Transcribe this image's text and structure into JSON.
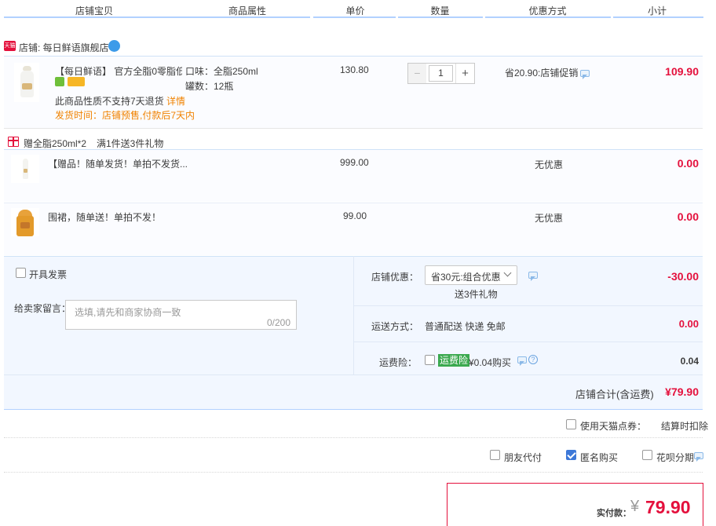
{
  "columns": {
    "shop_item": "店铺宝贝",
    "attributes": "商品属性",
    "unit_price": "单价",
    "quantity": "数量",
    "discount": "优惠方式",
    "subtotal": "小计"
  },
  "shop": {
    "badge": "天猫",
    "name": "店铺: 每日鲜语旗舰店"
  },
  "main_item": {
    "title": "【每日鲜语】 官方全脂0零脂低...",
    "attr_flavor": "口味：全脂250ml",
    "attr_count": "罐数：12瓶",
    "price": "130.80",
    "quantity": "1",
    "qty_minus": "−",
    "qty_plus": "+",
    "discount": "省20.90:店铺促销",
    "subtotal": "109.90",
    "notice": "此商品性质不支持7天退货",
    "notice_link": "详情",
    "ship_time": "发货时间：店铺预售,付款后7天内"
  },
  "gift": {
    "label": "赠全脂250ml*2",
    "rule": "满1件送3件礼物",
    "items": [
      {
        "title": "【赠品！随单发货！单拍不发货...",
        "price": "999.00",
        "discount": "无优惠",
        "subtotal": "0.00"
      },
      {
        "title": "围裙，随单送！单拍不发！",
        "price": "99.00",
        "discount": "无优惠",
        "subtotal": "0.00"
      }
    ]
  },
  "invoice": {
    "label": "开具发票"
  },
  "message": {
    "label": "给卖家留言：",
    "placeholder": "选填,请先和商家协商一致",
    "counter": "0/200"
  },
  "shop_discount": {
    "label": "店铺优惠：",
    "selected": "省30元:组合优惠",
    "sub": "送3件礼物",
    "amount": "-30.00"
  },
  "delivery": {
    "label": "运送方式：",
    "value": "普通配送 快递 免邮",
    "amount": "0.00"
  },
  "insurance": {
    "label": "运费险：",
    "badge": "运费险",
    "value": "¥0.04购买",
    "amount": "0.04"
  },
  "shop_total": {
    "label": "店铺合计(含运费)",
    "amount": "¥79.90"
  },
  "tmall_points": {
    "label": "使用天猫点券：",
    "note": "结算时扣除"
  },
  "options": {
    "friend_pay": "朋友代付",
    "anonymous": "匿名购买",
    "huabei": "花呗分期"
  },
  "payment": {
    "label": "实付款：",
    "currency": "¥",
    "amount": "79.90"
  }
}
